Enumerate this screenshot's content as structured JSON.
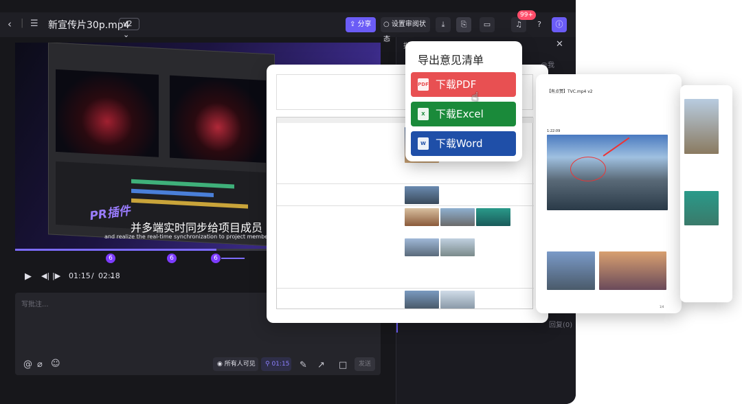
{
  "header": {
    "title": "新宣传片30p.mp4",
    "version": "v2",
    "share_label": "分享",
    "review_label": "设置审阅状态",
    "notif_badge": "99+",
    "help_icon": "?"
  },
  "player": {
    "subtitle_cn": "并多端实时同步给项目成员",
    "subtitle_en": "and realize the real-time synchronization to project members on mu",
    "pr_tag": "PR插件",
    "markers": [
      "6",
      "6",
      "6"
    ],
    "time_current": "01:15",
    "time_sep": "/",
    "time_total": "02:18",
    "progress": 0.55
  },
  "comment": {
    "placeholder": "写批注...",
    "visibility_label": "所有人可见",
    "timestamp": "01:15",
    "send_label": "发送"
  },
  "right_pane": {
    "partial_tab": "批注",
    "partial_me": "@我",
    "partial_count": "回复(0)"
  },
  "export_menu": {
    "title": "导出意见清单",
    "options": [
      {
        "label": "下载PDF",
        "file_icon": "PDF",
        "color": "#e85052"
      },
      {
        "label": "下载Excel",
        "file_icon": "X",
        "color": "#1a8a3a"
      },
      {
        "label": "下载Word",
        "file_icon": "W",
        "color": "#1f4fa8"
      }
    ]
  },
  "doc_preview_right": {
    "title": "【有点赞】TVC.mp4 v2",
    "time": "1:22:09",
    "page_num": "1/4"
  },
  "colors": {
    "accent": "#6b5cf6",
    "bg": "#17171b",
    "marker": "#7d3cff"
  }
}
